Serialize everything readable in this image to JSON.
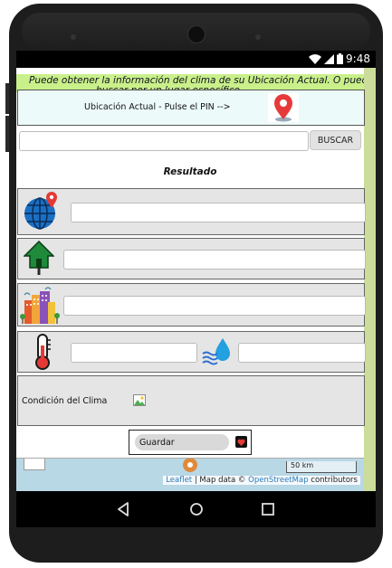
{
  "status_bar": {
    "time": "9:48",
    "icons": [
      "wifi-icon",
      "signal-icon",
      "battery-icon"
    ]
  },
  "marquee": {
    "line1": "Puede obtener la información del clima de su Ubicación Actual. O puede",
    "line2": "buscar por un lugar específico."
  },
  "location": {
    "label": "Ubicación Actual - Pulse el PIN -->",
    "icon": "map-pin-icon"
  },
  "search": {
    "placeholder": "",
    "value": "",
    "button_label": "BUSCAR"
  },
  "result": {
    "title": "Resultado"
  },
  "rows": {
    "country": {
      "icon": "globe-icon",
      "value": ""
    },
    "region": {
      "icon": "house-icon",
      "value": ""
    },
    "city": {
      "icon": "city-icon",
      "value": ""
    },
    "temperature": {
      "icon": "thermometer-icon",
      "value": ""
    },
    "humidity": {
      "icon": "water-drop-icon",
      "value": ""
    },
    "condition": {
      "label": "Condición del Clima",
      "icon": "image-icon"
    }
  },
  "save": {
    "label": "Guardar",
    "icon": "heart-icon"
  },
  "map": {
    "scale_label": "50 km",
    "attribution": {
      "leaflet": "Leaflet",
      "map_data": " | Map data © ",
      "osm": "OpenStreetMap",
      "contributors": " contributors"
    }
  },
  "colors": {
    "marquee_bg": "#c9f08a",
    "location_bg": "#ecfbf9",
    "row_bg": "#e5e5e5",
    "screen_side": "#cbdc9b"
  }
}
